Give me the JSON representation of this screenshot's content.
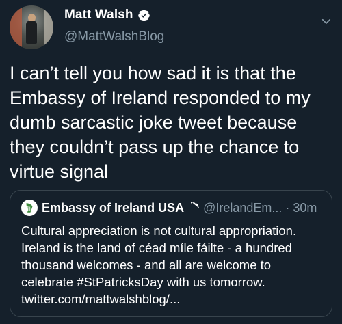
{
  "tweet": {
    "author": {
      "display_name": "Matt Walsh",
      "handle": "@MattWalshBlog",
      "verified_icon": "verified-badge-icon"
    },
    "body": "I can’t tell you how sad it is that the Embassy of Ireland responded to my dumb sarcastic joke tweet because they couldn’t pass up the chance to virtue signal",
    "menu_icon": "chevron-down-icon"
  },
  "quoted_tweet": {
    "author": {
      "display_name": "Embassy of Ireland USA",
      "handle": "@IrelandEm...",
      "verified_icon": "verified-badge-icon",
      "avatar_icon": "harp-crest-icon"
    },
    "separator": "·",
    "time": "30m",
    "body": "Cultural appreciation is not cultural appropriation.\nIreland is the land of céad míle fáilte - a hundred\nthousand welcomes - and all are welcome to\ncelebrate #StPatricksDay with us tomorrow.\ntwitter.com/mattwalshblog/..."
  },
  "colors": {
    "background": "#15202b",
    "text_primary": "#ffffff",
    "text_secondary": "#8899a6",
    "border": "#38444d",
    "verified_badge": "#ffffff"
  }
}
